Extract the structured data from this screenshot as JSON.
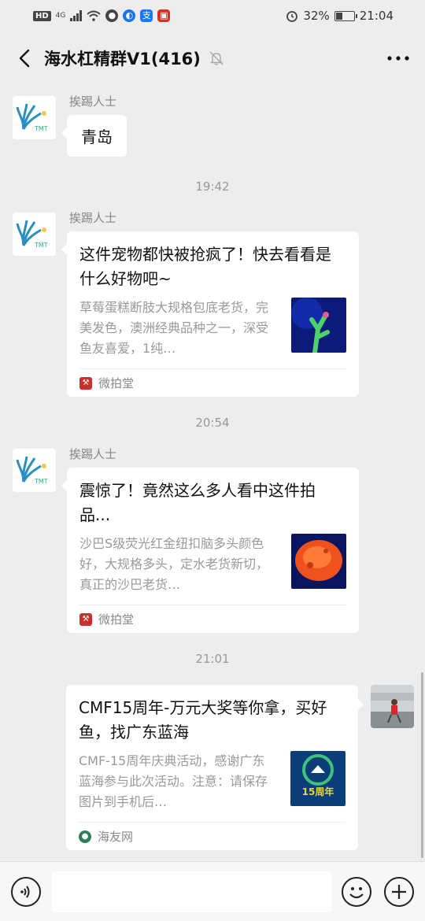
{
  "status_bar": {
    "hd": "HD",
    "network": "4G",
    "battery": "32%",
    "time": "21:04"
  },
  "header": {
    "title": "海水杠精群V1(416)"
  },
  "messages": [
    {
      "sender": "挨踢人士",
      "text": "青岛"
    },
    {
      "time": "19:42"
    },
    {
      "sender": "挨踢人士",
      "card": {
        "title": "这件宠物都快被抢疯了！快去看看是什么好物吧~",
        "desc": "草莓蛋糕断肢大规格包底老货，完美发色，澳洲经典品种之一，深受鱼友喜爱，1纯…",
        "source": "微拍堂"
      }
    },
    {
      "time": "20:54"
    },
    {
      "sender": "挨踢人士",
      "card": {
        "title": "震惊了！竟然这么多人看中这件拍品...",
        "desc": "沙巴S级荧光红金纽扣脑多头颜色好，大规格多头，定水老货新切，真正的沙巴老货…",
        "source": "微拍堂"
      }
    },
    {
      "time": "21:01"
    },
    {
      "card": {
        "title": "CMF15周年-万元大奖等你拿，买好鱼，找广东蓝海",
        "desc": "CMF-15周年庆典活动，感谢广东蓝海参与此次活动。注意：请保存图片到手机后…",
        "source": "海友网",
        "thumb_text": "15周年"
      }
    }
  ],
  "colors": {
    "background": "#ededed",
    "bubble": "#ffffff",
    "source_red": "#c9302c",
    "source_green": "#2e7d5b"
  },
  "icons": [
    "back-icon",
    "mute-icon",
    "more-icon",
    "voice-icon",
    "emoji-icon",
    "plus-icon"
  ]
}
